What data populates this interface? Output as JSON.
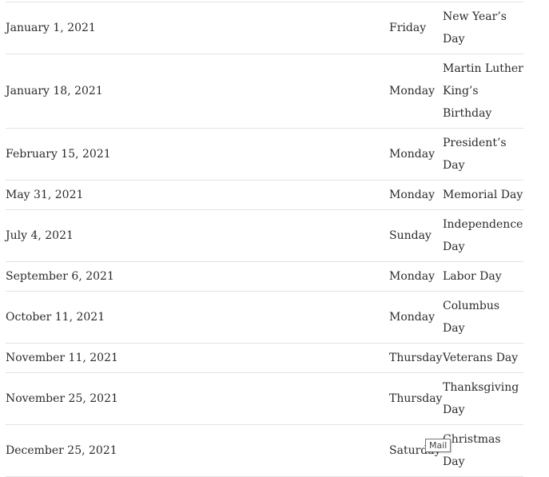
{
  "holidays": [
    {
      "date": "January 1, 2021",
      "day": "Friday",
      "name": "New Year’s Day"
    },
    {
      "date": "January 18, 2021",
      "day": "Monday",
      "name": "Martin Luther King’s Birthday"
    },
    {
      "date": "February 15, 2021",
      "day": "Monday",
      "name": "President’s Day"
    },
    {
      "date": "May 31, 2021",
      "day": "Monday",
      "name": "Memorial Day"
    },
    {
      "date": "July 4, 2021",
      "day": "Sunday",
      "name": "Independence Day"
    },
    {
      "date": "September 6, 2021",
      "day": "Monday",
      "name": "Labor Day"
    },
    {
      "date": "October 11, 2021",
      "day": "Monday",
      "name": "Columbus Day"
    },
    {
      "date": "November 11, 2021",
      "day": "Thursday",
      "name": "Veterans Day"
    },
    {
      "date": "November 25, 2021",
      "day": "Thursday",
      "name": "Thanksgiving Day"
    },
    {
      "date": "December 25, 2021",
      "day": "Saturday",
      "name": "Christmas Day"
    }
  ],
  "tooltip": {
    "text": "Mail"
  }
}
